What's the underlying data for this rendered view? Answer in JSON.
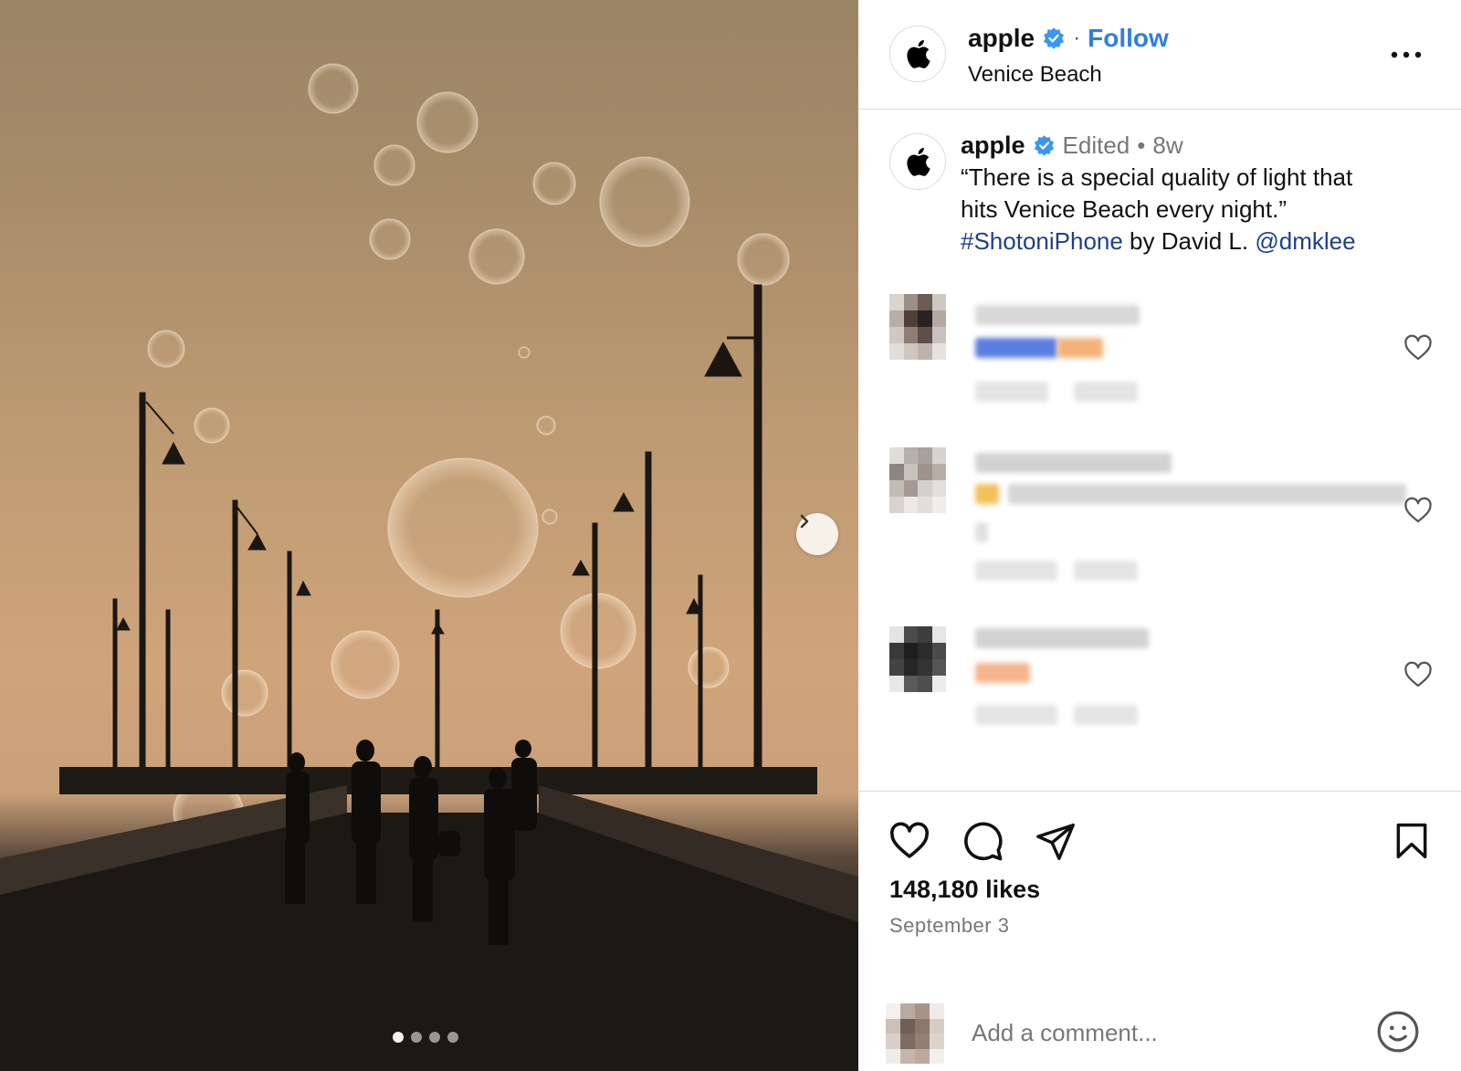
{
  "post": {
    "author": "apple",
    "verified": true,
    "follow_label": "Follow",
    "location": "Venice Beach",
    "carousel": {
      "slide_count": 4,
      "active_slide": 1
    }
  },
  "caption": {
    "author": "apple",
    "edited_label": "Edited",
    "separator": "•",
    "time_ago": "8w",
    "line1": "“There is a special quality of light that",
    "line2": "hits Venice Beach every night.”",
    "hashtag": "#ShotoniPhone",
    "by_text": " by David L. ",
    "mention": "@dmklee"
  },
  "actions": {
    "likes": "148,180 likes",
    "date": "September 3",
    "comment_placeholder": "Add a comment..."
  },
  "colors": {
    "accent_blue": "#2f7fe6",
    "link_dark_blue": "#1e3f8f",
    "verified_badge": "#3897f0"
  },
  "icons": [
    "apple-logo-icon",
    "verified-badge-icon",
    "more-icon",
    "chevron-right-icon",
    "heart-icon",
    "comment-icon",
    "share-icon",
    "bookmark-icon",
    "emoji-icon"
  ]
}
